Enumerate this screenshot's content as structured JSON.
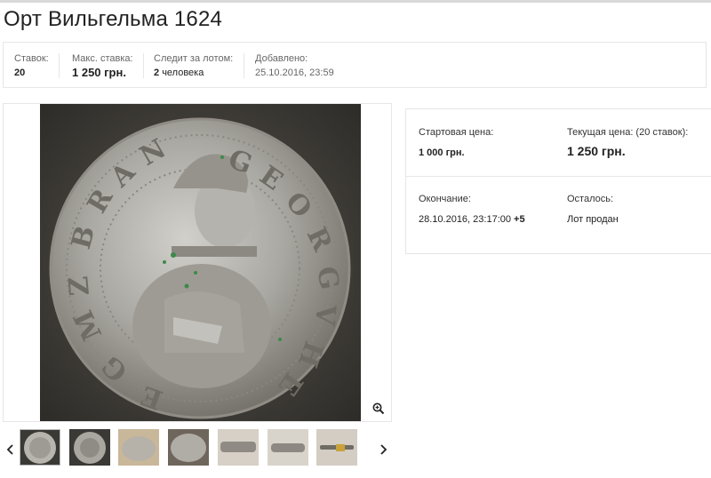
{
  "lot": {
    "title": "Орт Вильгельма 1624"
  },
  "stats": {
    "bids_label": "Ставок:",
    "bids_value": "20",
    "max_bid_label": "Макс. ставка:",
    "max_bid_value": "1 250 грн.",
    "watchers_label": "Следит за лотом:",
    "watchers_count": "2",
    "watchers_unit": "человека",
    "added_label": "Добавлено:",
    "added_value": "25.10.2016, 23:59"
  },
  "price": {
    "start_label": "Стартовая цена:",
    "start_value": "1 000 грн.",
    "current_label": "Текущая цена: (20 ставок):",
    "current_value": "1 250 грн.",
    "end_label": "Окончание:",
    "end_value": "28.10.2016, 23:17:00",
    "end_tz": "+5",
    "remaining_label": "Осталось:",
    "remaining_value": "Лот продан"
  },
  "gallery": {
    "main_image_icon": "coin-photo",
    "zoom_icon": "magnifier-plus-icon",
    "prev_icon": "chevron-left-icon",
    "next_icon": "chevron-right-icon",
    "thumbnail_count": 7,
    "active_thumbnail": 1
  },
  "colors": {
    "text": "#222222",
    "muted": "#666666",
    "border": "#e6e6e6",
    "coin_bg": "#3a3834",
    "coin_silver": "#b8b6b0"
  }
}
